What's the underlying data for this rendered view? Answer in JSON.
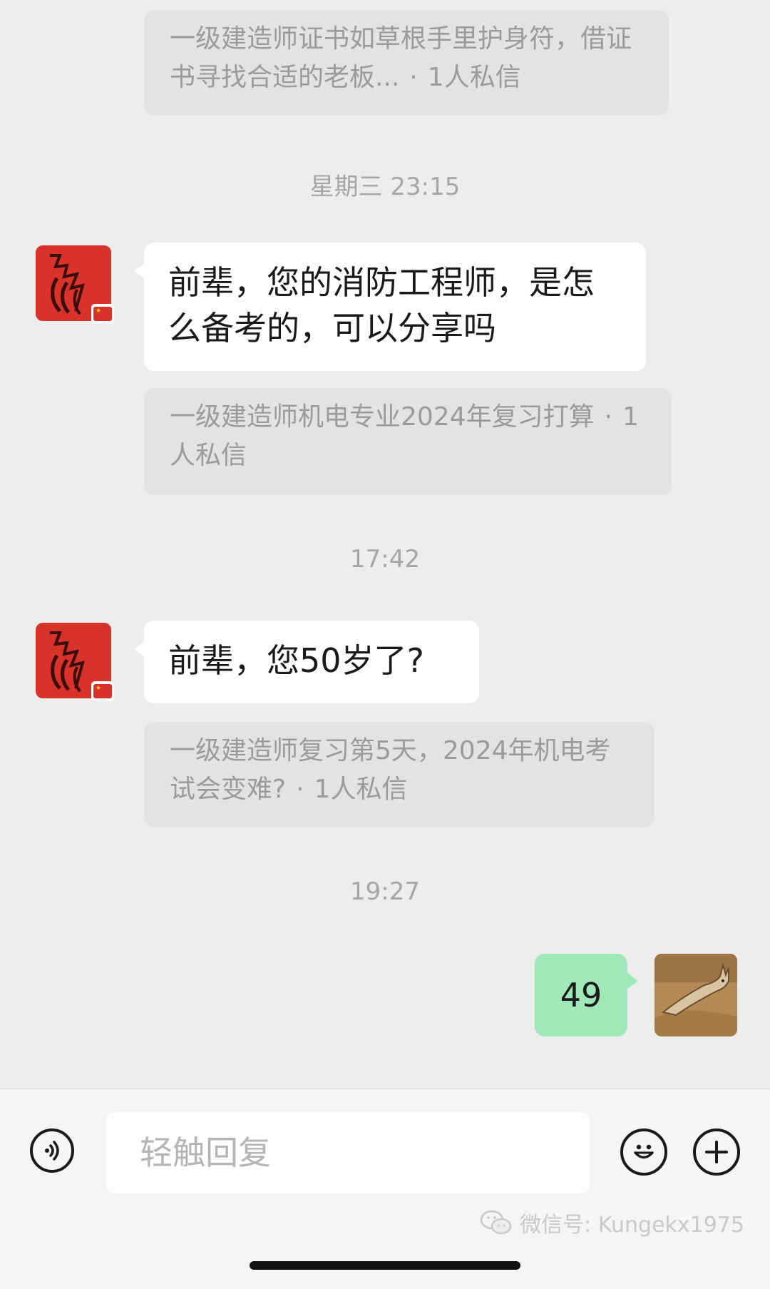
{
  "messages": {
    "ref1": {
      "text": "一级建造师证书如草根手里护身符，借证书寻找合适的老板...",
      "meta": "1人私信"
    },
    "time1": "星期三 23:15",
    "msg1": "前辈，您的消防工程师，是怎么备考的，可以分享吗",
    "ref2": {
      "text": "一级建造师机电专业2024年复习打算",
      "meta": "1人私信"
    },
    "time2": "17:42",
    "msg2": "前辈，您50岁了?",
    "ref3": {
      "text": "一级建造师复习第5天，2024年机电考试会变难?",
      "meta": "1人私信"
    },
    "time3": "19:27",
    "reply": "49"
  },
  "input": {
    "placeholder": "轻触回复"
  },
  "icons": {
    "voice": "voice-icon",
    "emoji": "emoji-icon",
    "plus": "plus-icon"
  },
  "watermark": {
    "text": "微信号: Kungekx1975"
  },
  "colors": {
    "background": "#ededed",
    "bubble_in": "#ffffff",
    "bubble_out": "#a0e8b8",
    "ref_card": "#e3e3e3",
    "avatar": "#d8322a"
  }
}
